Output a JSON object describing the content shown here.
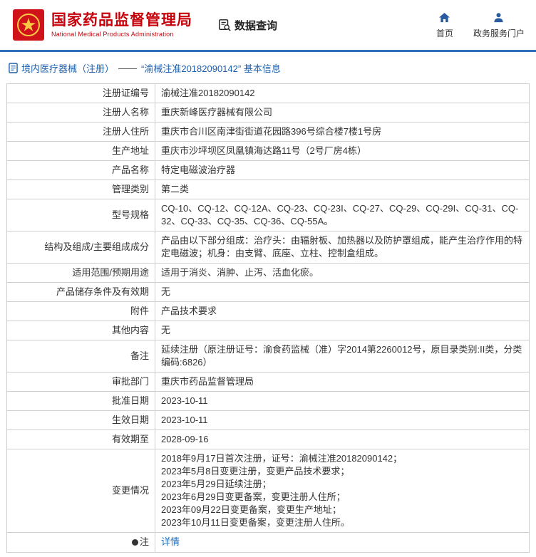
{
  "header": {
    "org_cn": "国家药品监督管理局",
    "org_en": "National Medical Products Administration",
    "data_query": "数据查询",
    "home": "首页",
    "portal": "政务服务门户"
  },
  "breadcrumb": {
    "section": "境内医疗器械（注册）",
    "separator": "——",
    "current": "“渝械注准20182090142” 基本信息"
  },
  "colors": {
    "brand_red": "#c7000b",
    "accent_blue": "#2f6db8",
    "link_blue": "#1b6dc1",
    "border_gray": "#cfcfcf"
  },
  "table": {
    "rows": [
      {
        "label": "注册证编号",
        "value": "渝械注准20182090142"
      },
      {
        "label": "注册人名称",
        "value": "重庆新峰医疗器械有限公司"
      },
      {
        "label": "注册人住所",
        "value": "重庆市合川区南津街街道花园路396号综合楼7楼1号房"
      },
      {
        "label": "生产地址",
        "value": "重庆市沙坪坝区凤凰镇海达路11号（2号厂房4栋）"
      },
      {
        "label": "产品名称",
        "value": "特定电磁波治疗器"
      },
      {
        "label": "管理类别",
        "value": "第二类"
      },
      {
        "label": "型号规格",
        "value": "CQ-10、CQ-12、CQ-12A、CQ-23、CQ-23I、CQ-27、CQ-29、CQ-29I、CQ-31、CQ-32、CQ-33、CQ-35、CQ-36、CQ-55A。"
      },
      {
        "label": "结构及组成/主要组成成分",
        "value": "产品由以下部分组成：治疗头：由辐射板、加热器以及防护罩组成，能产生治疗作用的特定电磁波；机身：由支臂、底座、立柱、控制盒组成。"
      },
      {
        "label": "适用范围/预期用途",
        "value": "适用于消炎、消肿、止泻、活血化瘀。"
      },
      {
        "label": "产品储存条件及有效期",
        "value": "无"
      },
      {
        "label": "附件",
        "value": "产品技术要求"
      },
      {
        "label": "其他内容",
        "value": "无"
      },
      {
        "label": "备注",
        "value": "延续注册（原注册证号：渝食药监械（准）字2014第2260012号，原目录类别:II类，分类编码:6826）"
      },
      {
        "label": "审批部门",
        "value": "重庆市药品监督管理局"
      },
      {
        "label": "批准日期",
        "value": "2023-10-11"
      },
      {
        "label": "生效日期",
        "value": "2023-10-11"
      },
      {
        "label": "有效期至",
        "value": "2028-09-16"
      },
      {
        "label": "变更情况",
        "value": "2018年9月17日首次注册，证号：渝械注准20182090142；\n2023年5月8日变更注册，变更产品技术要求；\n2023年5月29日延续注册；\n2023年6月29日变更备案，变更注册人住所；\n2023年09月22日变更备案，变更生产地址；\n2023年10月11日变更备案，变更注册人住所。"
      }
    ]
  },
  "note_row": {
    "label": "注",
    "link": "详情"
  }
}
